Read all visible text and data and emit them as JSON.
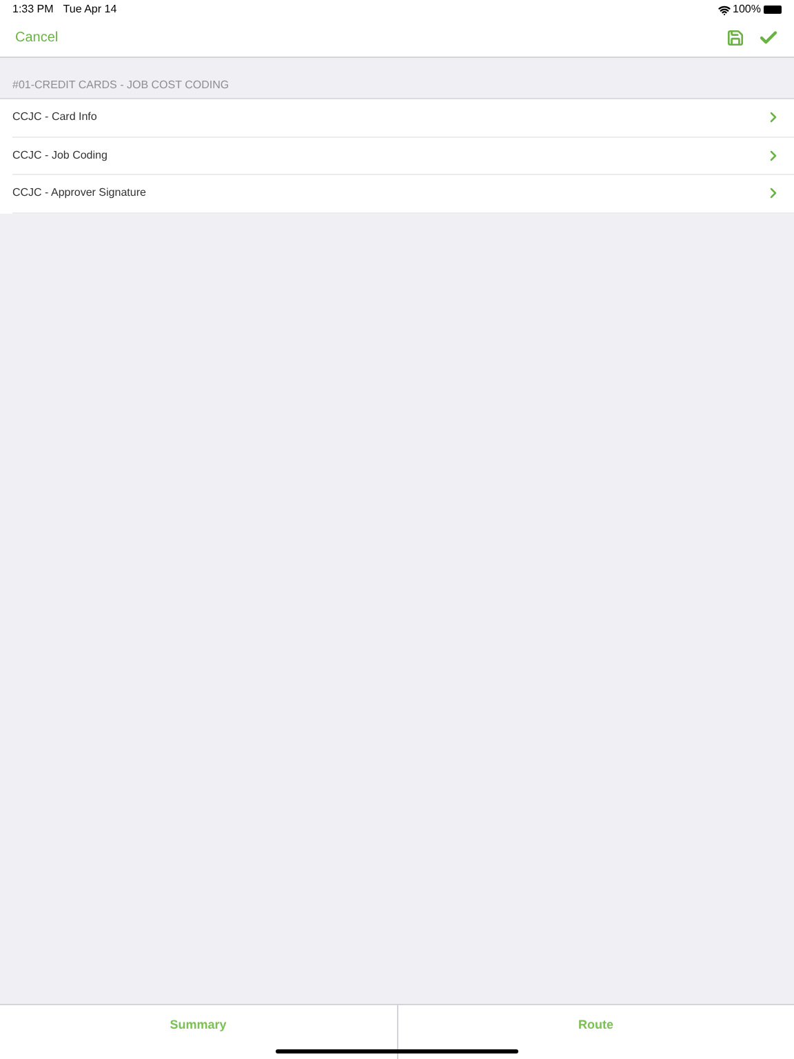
{
  "status_bar": {
    "time": "1:33 PM",
    "date": "Tue Apr 14",
    "battery": "100%"
  },
  "nav": {
    "cancel": "Cancel"
  },
  "section": {
    "title": "#01-CREDIT CARDS - JOB COST CODING",
    "items": [
      {
        "label": "CCJC - Card Info"
      },
      {
        "label": "CCJC - Job Coding"
      },
      {
        "label": "CCJC - Approver Signature"
      }
    ]
  },
  "tabs": [
    {
      "label": "Summary"
    },
    {
      "label": "Route"
    }
  ]
}
